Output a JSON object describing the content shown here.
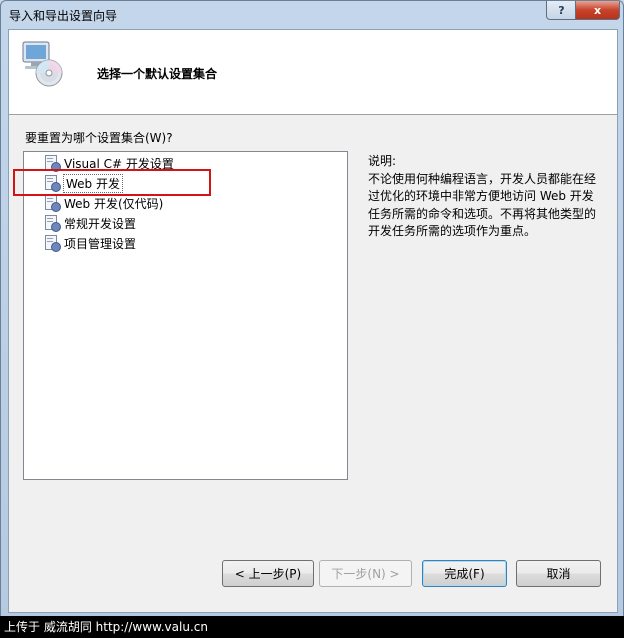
{
  "window": {
    "title": "导入和导出设置向导",
    "help_label": "?",
    "close_label": "x"
  },
  "header": {
    "title": "选择一个默认设置集合"
  },
  "prompt": "要重置为哪个设置集合(W)?",
  "settings_list": {
    "items": [
      {
        "label": "Visual C# 开发设置"
      },
      {
        "label": "Web 开发"
      },
      {
        "label": "Web 开发(仅代码)"
      },
      {
        "label": "常规开发设置"
      },
      {
        "label": "项目管理设置"
      }
    ],
    "selected_index": 1
  },
  "description": {
    "heading": "说明:",
    "body": "不论使用何种编程语言，开发人员都能在经过优化的环境中非常方便地访问 Web 开发任务所需的命令和选项。不再将其他类型的开发任务所需的选项作为重点。"
  },
  "buttons": {
    "back": "< 上一步(P)",
    "next": "下一步(N) >",
    "finish": "完成(F)",
    "cancel": "取消"
  },
  "watermark": "上传于 威流胡同 http://www.valu.cn",
  "colors": {
    "highlight_border": "#d21414"
  }
}
